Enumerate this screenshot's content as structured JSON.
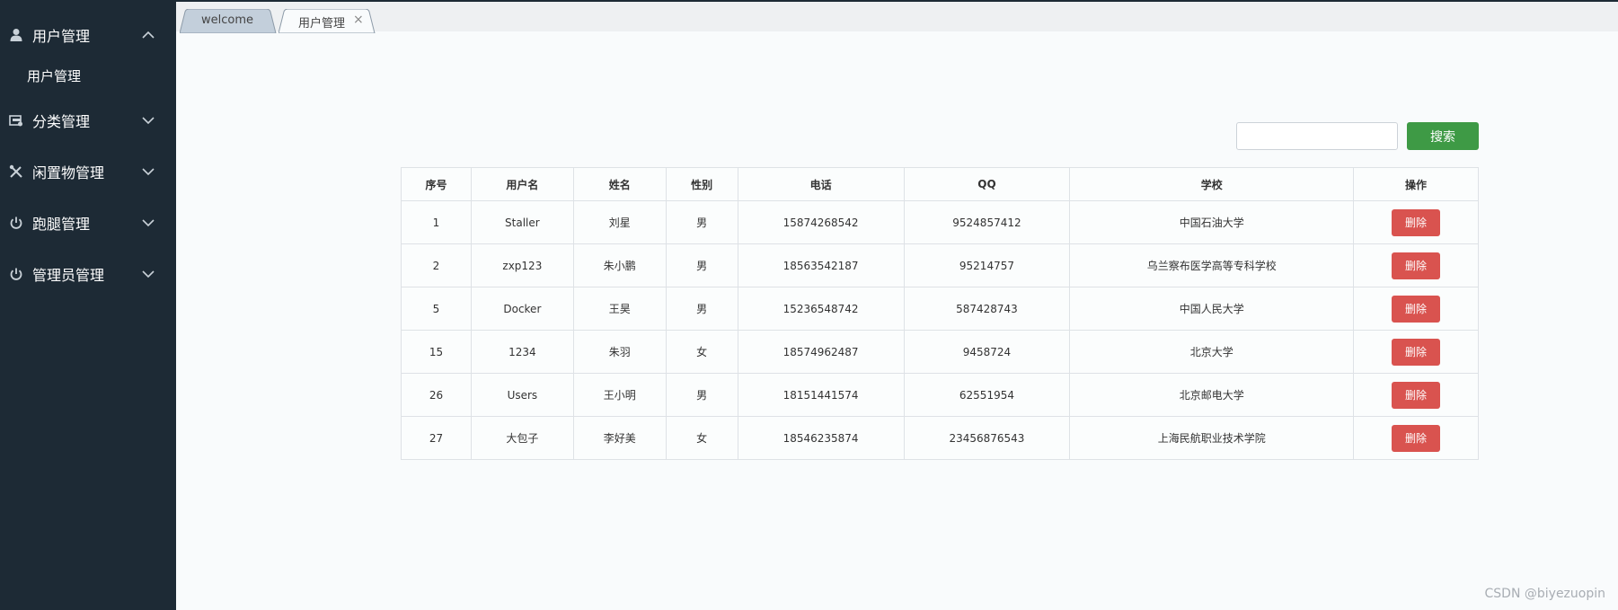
{
  "sidebar": {
    "groups": [
      {
        "label": "用户管理",
        "icon": "user-icon",
        "expanded": true,
        "children": [
          "用户管理"
        ]
      },
      {
        "label": "分类管理",
        "icon": "category-icon",
        "expanded": false
      },
      {
        "label": "闲置物管理",
        "icon": "tools-icon",
        "expanded": false
      },
      {
        "label": "跑腿管理",
        "icon": "power-icon",
        "expanded": false
      },
      {
        "label": "管理员管理",
        "icon": "power-icon",
        "expanded": false
      }
    ]
  },
  "tabs": [
    {
      "label": "welcome",
      "active": false
    },
    {
      "label": "用户管理",
      "active": true,
      "close": "×"
    }
  ],
  "search": {
    "value": "",
    "placeholder": "",
    "button_label": "搜索"
  },
  "table": {
    "columns": [
      "序号",
      "用户名",
      "姓名",
      "性别",
      "电话",
      "QQ",
      "学校",
      "操作"
    ],
    "rows": [
      {
        "id": "1",
        "username": "Staller",
        "name": "刘星",
        "gender": "男",
        "phone": "15874268542",
        "qq": "9524857412",
        "school": "中国石油大学",
        "action": "删除"
      },
      {
        "id": "2",
        "username": "zxp123",
        "name": "朱小鹏",
        "gender": "男",
        "phone": "18563542187",
        "qq": "95214757",
        "school": "乌兰察布医学高等专科学校",
        "action": "删除"
      },
      {
        "id": "5",
        "username": "Docker",
        "name": "王昊",
        "gender": "男",
        "phone": "15236548742",
        "qq": "587428743",
        "school": "中国人民大学",
        "action": "删除"
      },
      {
        "id": "15",
        "username": "1234",
        "name": "朱羽",
        "gender": "女",
        "phone": "18574962487",
        "qq": "9458724",
        "school": "北京大学",
        "action": "删除"
      },
      {
        "id": "26",
        "username": "Users",
        "name": "王小明",
        "gender": "男",
        "phone": "18151441574",
        "qq": "62551954",
        "school": "北京邮电大学",
        "action": "删除"
      },
      {
        "id": "27",
        "username": "大包子",
        "name": "李好美",
        "gender": "女",
        "phone": "18546235874",
        "qq": "23456876543",
        "school": "上海民航职业技术学院",
        "action": "删除"
      }
    ]
  },
  "watermark": "CSDN @biyezuopin",
  "colors": {
    "sidebar_bg": "#1d2a35",
    "search_button": "#3e9a45",
    "delete_button": "#d9534f",
    "page_bg": "#f9fbfc"
  }
}
